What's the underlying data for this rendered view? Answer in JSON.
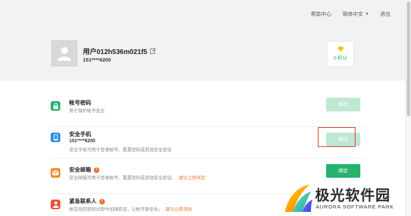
{
  "topnav": {
    "help": "帮助中心",
    "language": "简体中文",
    "logout": "退出"
  },
  "profile": {
    "username": "用户012h536m021f5",
    "phone": "151****6200",
    "points": "0 积分"
  },
  "rows": [
    {
      "title": "帐号密码",
      "subtitle": "用于保护帐号安全",
      "button": "修改",
      "icon": "lock-icon",
      "color": "#27b26e"
    },
    {
      "title": "安全手机",
      "phone": "151****6200",
      "subtitle": "安全手机可用于登录帐号、重置密码或其他安全验证",
      "button": "修改",
      "icon": "phone-icon",
      "color": "#2f8ae6"
    },
    {
      "title": "安全邮箱",
      "subtitle": "安全邮箱可用于登录帐号、重置密码或其他安全验证。",
      "link": "建议立即绑定",
      "button": "绑定",
      "icon": "mail-icon",
      "color": "#f08a24"
    },
    {
      "title": "紧急联系人",
      "subtitle": "帐在找回密码过程中加强验证，让帐号更安全。",
      "link": "建议立即添加",
      "icon": "contact-icon",
      "color": "#e8523a"
    }
  ],
  "watermark": {
    "title": "极光软件园",
    "subtitle": "AURORA SOFTWARE PARK"
  },
  "colors": {
    "accent": "#27b26e",
    "accent_light": "#bfe8d2",
    "warning": "#e8692c",
    "highlight": "#d9362b"
  }
}
